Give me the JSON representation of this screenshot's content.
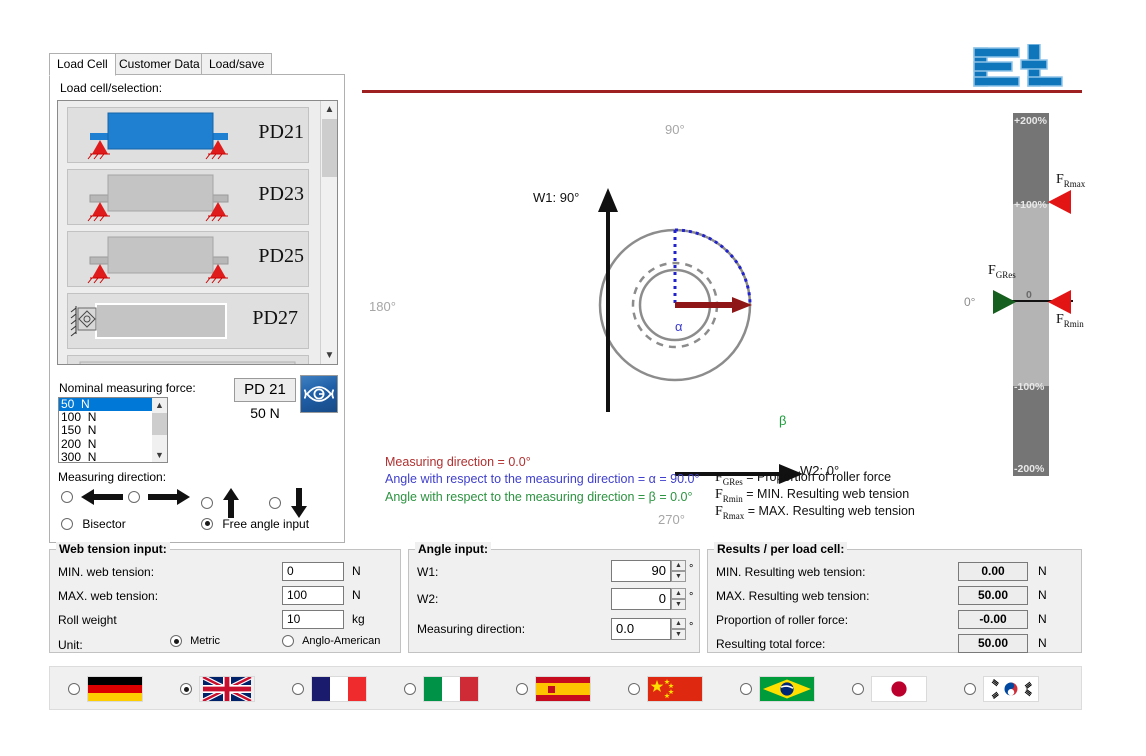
{
  "logo": {
    "name": "ET"
  },
  "tabs": [
    {
      "label": "Load Cell",
      "active": true
    },
    {
      "label": "Customer Data",
      "active": false
    },
    {
      "label": "Load/save",
      "active": false
    }
  ],
  "loadcell_panel": {
    "label": "Load cell/selection:",
    "items": [
      {
        "name": "PD21",
        "selected": true
      },
      {
        "name": "PD23",
        "selected": false
      },
      {
        "name": "PD25",
        "selected": false
      },
      {
        "name": "PD27",
        "selected": false
      },
      {
        "name": "",
        "selected": false
      }
    ],
    "nominal_label": "Nominal measuring force:",
    "force_options": [
      "50  N",
      "100  N",
      "150  N",
      "200  N",
      "300  N"
    ],
    "force_selected": "50  N",
    "pd_box": "PD 21",
    "pd_force": "50 N",
    "eye_icon": "eye-icon",
    "measuring_direction_label": "Measuring direction:",
    "direction_options": [
      "left-arrow",
      "right-arrow",
      "up-arrow",
      "down-arrow"
    ],
    "direction_selected": -1,
    "bisector_label": "Bisector",
    "bisector_selected": false,
    "free_angle_label": "Free angle input",
    "free_angle_selected": true
  },
  "diagram": {
    "deg_90": "90°",
    "deg_180": "180°",
    "deg_270": "270°",
    "w1_label": "W1: 90°",
    "w2_label": "W2: 0°",
    "alpha_symbol": "α",
    "beta_symbol": "β",
    "legend": [
      {
        "text": "Measuring direction = 0.0°",
        "color": "#b03030"
      },
      {
        "text": "Angle with respect to the measuring direction = α = 90.0°",
        "color": "#4040cc"
      },
      {
        "text": "Angle with respect to the measuring direction = β = 0.0°",
        "color": "#2c9340"
      }
    ],
    "force_key": [
      {
        "sym": "F",
        "sub": "GRes",
        "desc": " = Proportion of roller force"
      },
      {
        "sym": "F",
        "sub": "Rmin",
        "desc": " = MIN. Resulting web tension"
      },
      {
        "sym": "F",
        "sub": "Rmax",
        "desc": " = MAX. Resulting web tension"
      }
    ]
  },
  "gauge": {
    "ticks": [
      "+200%",
      "+100%",
      "0",
      "-100%",
      "-200%"
    ],
    "zero_deg": "0°",
    "markers": [
      {
        "label_sym": "F",
        "label_sub": "Rmax",
        "color": "#e31414",
        "side": "right"
      },
      {
        "label_sym": "F",
        "label_sub": "GRes",
        "color": "#16601f",
        "side": "left"
      },
      {
        "label_sym": "F",
        "label_sub": "Rmin",
        "color": "#e31414",
        "side": "right"
      }
    ]
  },
  "web_tension": {
    "title": "Web tension input:",
    "rows": [
      {
        "label": "MIN. web tension:",
        "value": "0",
        "unit": "N"
      },
      {
        "label": "MAX. web tension:",
        "value": "100",
        "unit": "N"
      },
      {
        "label": "Roll weight",
        "value": "10",
        "unit": "kg"
      }
    ],
    "unit_label": "Unit:",
    "unit_options": [
      {
        "label": "Metric",
        "selected": true
      },
      {
        "label": "Anglo-American",
        "selected": false
      }
    ]
  },
  "angle_input": {
    "title": "Angle input:",
    "rows": [
      {
        "label": "W1:",
        "value": "90",
        "unit": "°",
        "align": "right"
      },
      {
        "label": "W2:",
        "value": "0",
        "unit": "°",
        "align": "right"
      },
      {
        "label": "Measuring direction:",
        "value": "0.0",
        "unit": "°",
        "align": "left"
      }
    ]
  },
  "results": {
    "title": "Results / per load cell:",
    "rows": [
      {
        "label": "MIN. Resulting web tension:",
        "value": "0.00",
        "unit": "N"
      },
      {
        "label": "MAX. Resulting web tension:",
        "value": "50.00",
        "unit": "N"
      },
      {
        "label": "Proportion of roller force:",
        "value": "-0.00",
        "unit": "N"
      },
      {
        "label": "Resulting total force:",
        "value": "50.00",
        "unit": "N"
      }
    ]
  },
  "languages": [
    {
      "name": "germany",
      "selected": false
    },
    {
      "name": "united-kingdom",
      "selected": true
    },
    {
      "name": "france",
      "selected": false
    },
    {
      "name": "italy",
      "selected": false
    },
    {
      "name": "spain",
      "selected": false
    },
    {
      "name": "china",
      "selected": false
    },
    {
      "name": "brazil",
      "selected": false
    },
    {
      "name": "japan",
      "selected": false
    },
    {
      "name": "south-korea",
      "selected": false
    }
  ],
  "colors": {
    "accent_blue": "#0f76bc",
    "rule_red": "#9e2020",
    "selection_blue": "#0078d7",
    "alpha_blue": "#3a3ad0",
    "beta_green": "#1a9e3a",
    "arrow_dark_red": "#8e1616"
  }
}
